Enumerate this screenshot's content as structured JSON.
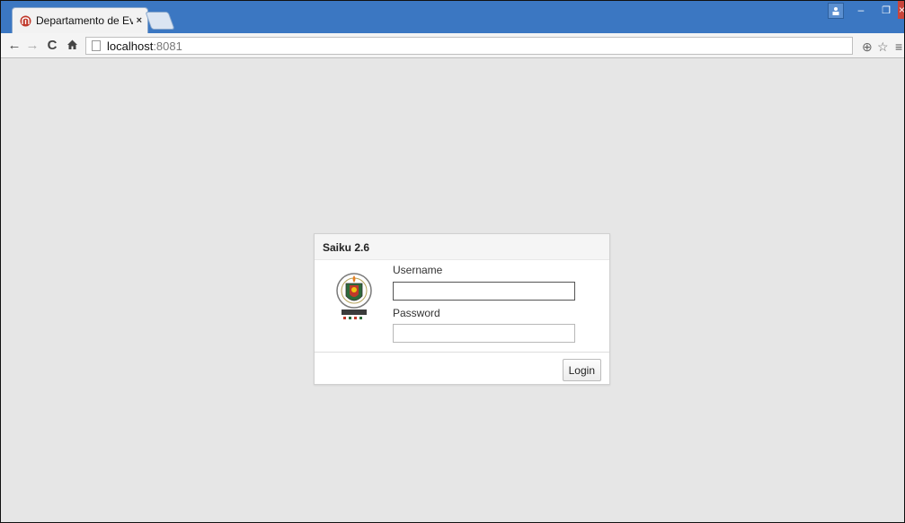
{
  "browser": {
    "tab_title": "Departamento de Evaluaci",
    "tab_close": "×",
    "url_host": "localhost",
    "url_port": ":8081",
    "accent_color": "#3b77c2",
    "icons": {
      "back": "←",
      "forward": "→",
      "reload": "C",
      "home": "⌂",
      "zoom": "⊕",
      "bookmark": "☆",
      "menu": "≡",
      "minimize": "–",
      "maximize": "❐",
      "close": "×",
      "user": "≗"
    }
  },
  "dialog": {
    "title": "Saiku 2.6",
    "username_label": "Username",
    "username_value": "",
    "password_label": "Password",
    "password_value": "",
    "login_label": "Login"
  }
}
